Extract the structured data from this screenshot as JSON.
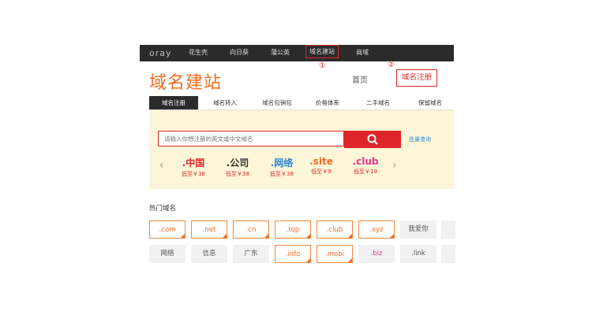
{
  "topbar": {
    "logo": "oray",
    "nav": [
      "花生壳",
      "向日葵",
      "蒲公英",
      "域名建站",
      "商域"
    ],
    "annotation_1": "①"
  },
  "header": {
    "brand": "域名建站",
    "home_link": "首页",
    "register_link": "域名注册",
    "annotation_2": "②"
  },
  "tabs": [
    "域名注册",
    "域名转入",
    "域名包销包",
    "价格体系",
    "二手域名",
    "保留域名"
  ],
  "search": {
    "placeholder": "请输入你想注册的英文或中文域名",
    "bulk_link": "批量查询"
  },
  "tld_carousel": [
    {
      "name": ".中国",
      "price": "低至￥38",
      "color": "#e0252a"
    },
    {
      "name": ".公司",
      "price": "低至￥38",
      "color": "#333333"
    },
    {
      "name": ".网络",
      "price": "低至￥38",
      "color": "#2f86d6"
    },
    {
      "name": ".site",
      "price": "低至￥9",
      "color": "#f36b21"
    },
    {
      "name": ".club",
      "price": "低至￥19",
      "color": "#e03a8a"
    }
  ],
  "hot": {
    "title": "热门域名",
    "row1": [
      ".com",
      ".net",
      ".cn",
      ".top",
      ".club",
      ".xyz",
      "我爱你"
    ],
    "row2": [
      "网络",
      "信息",
      "广东",
      ".info",
      ".mobi",
      ".biz",
      ".link"
    ]
  }
}
